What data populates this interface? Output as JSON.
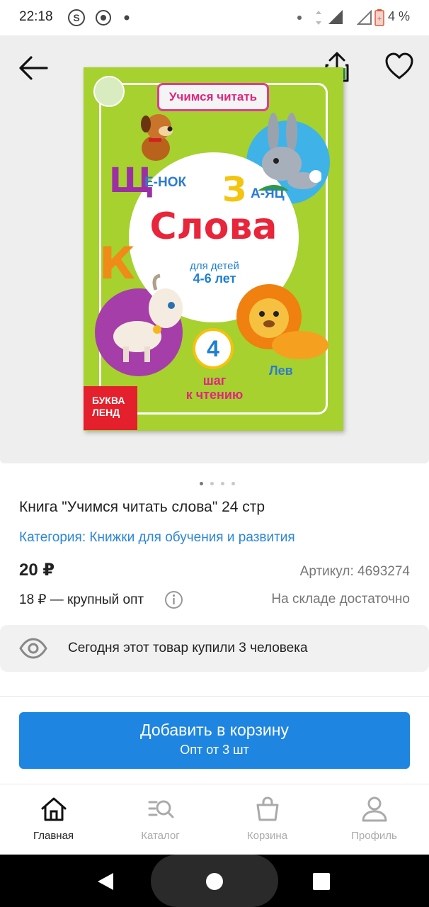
{
  "status_bar": {
    "time": "22:18",
    "battery": "4 %"
  },
  "book_cover": {
    "series": "Учимся читать",
    "title": "Слова",
    "age_line1": "для детей",
    "age_line2": "4-6 лет",
    "letter1": "Щ",
    "word1": "Е-НОК",
    "letter2": "З",
    "word2": "А-ЯЦ",
    "letter3": "К",
    "step_number": "4",
    "step_text_line1": "шаг",
    "step_text_line2": "к чтению",
    "lion_label": "Лев",
    "brand_line1": "БУКВА",
    "brand_line2": "ЛЕНД"
  },
  "gallery": {
    "dot_count": 4,
    "active_dot": 0
  },
  "product": {
    "title": "Книга \"Учимся читать слова\" 24 стр",
    "category": "Категория: Книжки для обучения и развития",
    "price": "20 ₽",
    "article": "Артикул: 4693274",
    "wholesale": "18 ₽ — крупный опт",
    "stock": "На складе достаточно",
    "bought_today": "Сегодня этот товар купили 3 человека"
  },
  "cart_button": {
    "label": "Добавить в корзину",
    "sublabel": "Опт от 3 шт"
  },
  "tabs": [
    {
      "label": "Главная",
      "icon": "home-icon",
      "active": true
    },
    {
      "label": "Каталог",
      "icon": "catalog-search-icon",
      "active": false
    },
    {
      "label": "Корзина",
      "icon": "shopping-bag-icon",
      "active": false
    },
    {
      "label": "Профиль",
      "icon": "profile-icon",
      "active": false
    }
  ],
  "colors": {
    "accent": "#1e85e0",
    "link": "#2c86d6",
    "cover_green": "#a6d12f",
    "cover_title_red": "#e8253a"
  }
}
